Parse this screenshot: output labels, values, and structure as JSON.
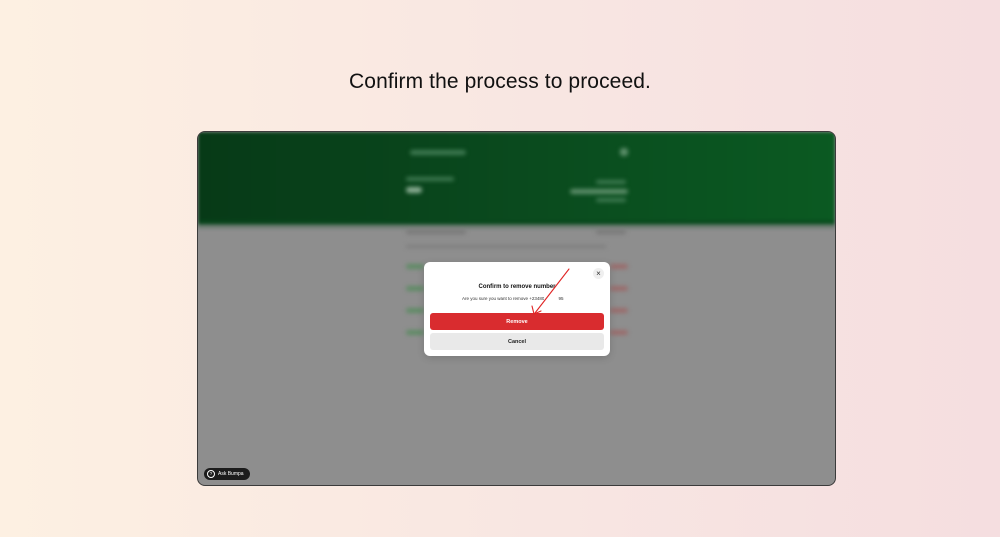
{
  "headline": "Confirm the process to proceed.",
  "modal": {
    "title": "Confirm to remove number",
    "message_prefix": "Are you sure you want to remove +23480",
    "message_suffix": "95",
    "remove_label": "Remove",
    "cancel_label": "Cancel",
    "close_glyph": "×"
  },
  "assistant": {
    "label": "Ask Bumpa",
    "icon_glyph": "?"
  },
  "colors": {
    "header_green": "#0a4a1e",
    "remove_red": "#d92c2f",
    "annotation_red": "#e02424",
    "overlay_gray": "#8e8e8e"
  }
}
